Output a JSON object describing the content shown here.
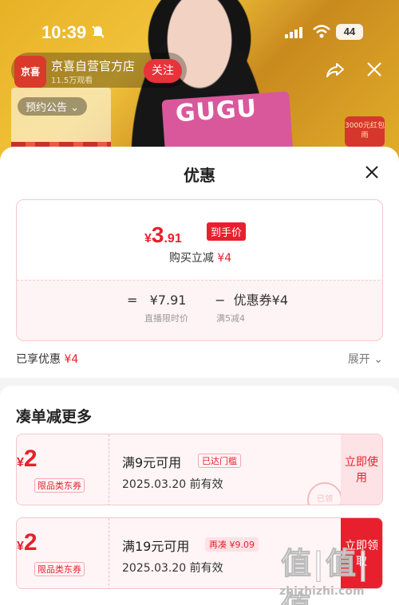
{
  "status_bar": {
    "time": "10:39",
    "battery": "44"
  },
  "live": {
    "store_name": "京喜自营官方店",
    "viewers": "11.5万观看",
    "follow_label": "关注",
    "notice_label": "预约公告",
    "logo_text": "京喜",
    "bag_text": "GUGU",
    "red_packet": "3000元红包雨"
  },
  "sheet": {
    "title": "优惠",
    "price": {
      "currency": "¥",
      "integer": "3",
      "decimal": ".91",
      "tag": "到手价"
    },
    "reduce": {
      "label": "购买立减",
      "amount": "¥4"
    },
    "calc": {
      "equals": "=",
      "live_price": "¥7.91",
      "minus": "−",
      "coupon_label": "优惠券¥4",
      "live_price_caption": "直播限时价",
      "coupon_caption": "满5减4"
    },
    "enjoyed": {
      "label": "已享优惠",
      "amount": "¥4"
    },
    "expand_label": "展开"
  },
  "more": {
    "title": "凑单减更多",
    "coupons": [
      {
        "currency": "¥",
        "amount": "2",
        "category": "限品类东券",
        "condition": "满9元可用",
        "tag": "已达门槛",
        "expire": "2025.03.20 前有效",
        "action": "立即使用",
        "stamp": "已领"
      },
      {
        "currency": "¥",
        "amount": "2",
        "category": "限品类东券",
        "condition": "满19元可用",
        "tag": "再凑 ¥9.09",
        "expire": "2025.03.20 前有效",
        "action": "立即领取"
      }
    ]
  },
  "watermark": {
    "main": "值|值|值",
    "sub": "zhizhizhi.com"
  },
  "colors": {
    "accent": "#e8202d",
    "sheet_bg": "#f4f4f4"
  }
}
